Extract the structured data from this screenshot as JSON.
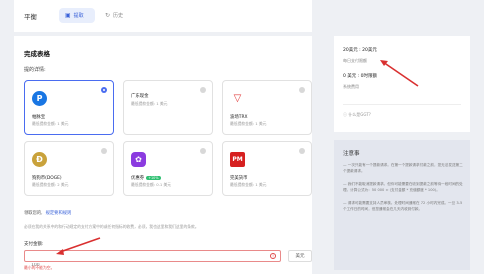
{
  "header": {
    "title": "平衡",
    "tabs": [
      {
        "label": "提取"
      },
      {
        "label": "历史"
      }
    ]
  },
  "withdraw": {
    "section_title": "完成表格",
    "details_label": "提的详情:",
    "methods": [
      {
        "name": "帕脉宝",
        "fee": "最低提款金额: 1 美元",
        "logo": "P",
        "color": "#1976e3",
        "selected": true
      },
      {
        "name": "广东现金",
        "fee": "最低提款金额: 1 美元",
        "logo": "",
        "color": "#ffffff",
        "selected": false
      },
      {
        "name": "波场TRX",
        "fee": "最低提款金额: 1 美元",
        "logo": "▽",
        "color": "#e03a3a",
        "selected": false
      },
      {
        "name": "狗狗币(DOGE)",
        "fee": "最低提款金额: 2 美元",
        "logo": "Ð",
        "color": "#c9a23b",
        "selected": false
      },
      {
        "name": "优惠券",
        "badge": "+10%",
        "fee": "最低提款金额: 0.1 美元",
        "logo": "✿",
        "color": "#8b3be0",
        "selected": false
      },
      {
        "name": "完美货币",
        "fee": "最低提款金额: 1 美元",
        "logo": "PM",
        "color": "#d62020",
        "selected": false
      }
    ],
    "terms_prefix": "领取您的,",
    "terms_link": "规定要和规则",
    "notice": "必须在我的关系中的和行动规定的支付方案中的或任何指标的收费，必须，我也这里和我们这里的条款。",
    "amount_label": "支付金额:",
    "amount_placeholder": "100",
    "amount_unit": "美元",
    "amount_error": "最小的不能为空。"
  },
  "balance_panel": {
    "line1": "20美元 : 20美元",
    "line2": "每日支付限额",
    "line3": "0 美元 : 0时限额",
    "line4": "系统费用",
    "help": "什么是GGT?"
  },
  "notes": {
    "title": "注意事",
    "items": [
      "一次只能有一个提款请求。在第一个提款请求付款之前，您无法发送第二个提款请求。",
      "我们不能取消提款请求。但你可能需要在收到提款之前等待一段时间的处理。计算公式为：50 000 ≈ (支付金额 * 充值额度 * 100)。",
      "请求可能需要支持人员审核。处理时间通常在 72 小时内完成。一旦 3-5 个工作日的时间，但您通常会在几天内收到付款。"
    ]
  },
  "colors": {
    "accent": "#3b63d9",
    "error": "#e04b4b",
    "annotation_red": "#d93030"
  }
}
